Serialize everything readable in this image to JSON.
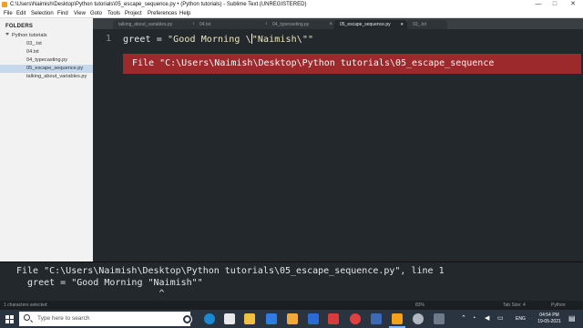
{
  "window": {
    "title": "C:\\Users\\Naimish\\Desktop\\Python tutorials\\05_escape_sequence.py • (Python tutorials) - Sublime Text (UNREGISTERED)",
    "min_glyph": "—",
    "max_glyph": "□",
    "close_glyph": "✕"
  },
  "menu": [
    "File",
    "Edit",
    "Selection",
    "Find",
    "View",
    "Goto",
    "Tools",
    "Project",
    "Preferences",
    "Help"
  ],
  "sidebar": {
    "heading": "FOLDERS",
    "folder": "Python tutorials",
    "files": [
      "03_.txt",
      "04.txt",
      "04_typecasting.py",
      "05_escape_sequence.py",
      "talking_about_variables.py"
    ],
    "selected_index": 3
  },
  "tabs": [
    {
      "label": "talking_about_variables.py",
      "close": "×"
    },
    {
      "label": "04.txt",
      "close": "×"
    },
    {
      "label": "04_typecasting.py",
      "close": "×"
    },
    {
      "label": "05_escape_sequence.py",
      "close": "●"
    },
    {
      "label": "03_.txt",
      "close": ""
    }
  ],
  "editor": {
    "line_number": "1",
    "code_prefix": "greet = ",
    "code_string_a": "\"Good Morning \\",
    "code_string_b": "\"Naimish\\\"\"",
    "error_text": "File \"C:\\Users\\Naimish\\Desktop\\Python tutorials\\05_escape_sequence"
  },
  "output": {
    "line1": "File \"C:\\Users\\Naimish\\Desktop\\Python tutorials\\05_escape_sequence.py\", line 1",
    "line2": "  greet = \"Good Morning \"Naimish\"\"",
    "line3": "                          ^"
  },
  "statusbar": {
    "left": "1 characters selected",
    "percent": "83%",
    "tab_size": "Tab Size: 4",
    "syntax": "Python"
  },
  "taskbar": {
    "search_placeholder": "Type here to search",
    "language": "ENG",
    "time": "04:54 PM",
    "date": "19-05-2021"
  },
  "colors": {
    "editor_bg": "#22282c",
    "error_bg": "#9c2a2c",
    "sidebar_bg": "#f2f2f2",
    "taskbar_bg": "#2a3441"
  }
}
